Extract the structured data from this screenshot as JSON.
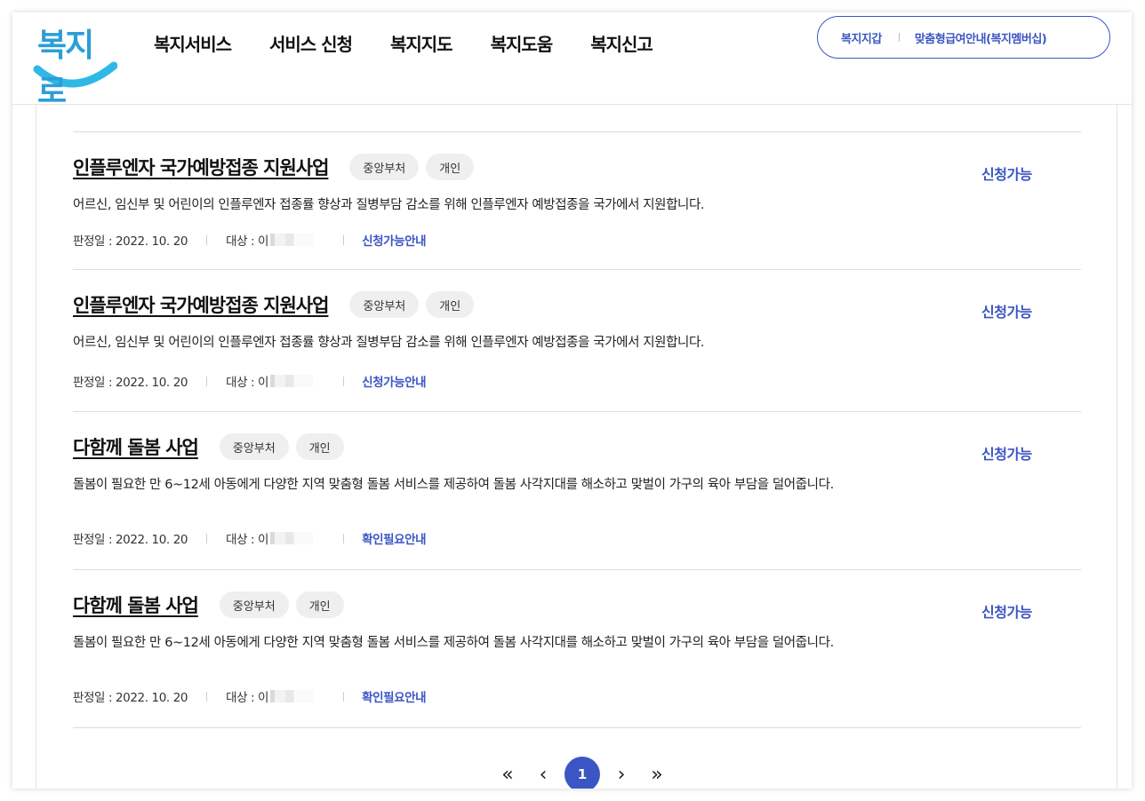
{
  "header": {
    "logo_text": "복지로",
    "nav": [
      "복지서비스",
      "서비스 신청",
      "복지지도",
      "복지도움",
      "복지신고"
    ],
    "util": [
      "복지지갑",
      "맞춤형급여안내(복지멤버십)"
    ]
  },
  "services": [
    {
      "title": "인플루엔자 국가예방접종 지원사업",
      "tags": [
        "중앙부처",
        "개인"
      ],
      "status": "신청가능",
      "description": "어르신, 임신부 및 어린이의 인플루엔자 접종률 향상과 질병부담 감소를 위해  인플루엔자 예방접종을 국가에서 지원합니다.",
      "date_label": "판정일 : 2022. 10. 20",
      "target_label": "대상 : 이",
      "link": "신청가능안내"
    },
    {
      "title": "인플루엔자 국가예방접종 지원사업",
      "tags": [
        "중앙부처",
        "개인"
      ],
      "status": "신청가능",
      "description": "어르신, 임신부 및 어린이의 인플루엔자 접종률 향상과 질병부담 감소를 위해  인플루엔자 예방접종을 국가에서 지원합니다.",
      "date_label": "판정일 : 2022. 10. 20",
      "target_label": "대상 : 이",
      "link": "신청가능안내"
    },
    {
      "title": "다함께 돌봄 사업",
      "tags": [
        "중앙부처",
        "개인"
      ],
      "status": "신청가능",
      "description": "돌봄이 필요한 만 6~12세 아동에게 다양한 지역 맞춤형 돌봄 서비스를 제공하여 돌봄 사각지대를 해소하고 맞벌이 가구의 육아 부담을 덜어줍니다.",
      "date_label": "판정일 : 2022. 10. 20",
      "target_label": "대상 : 이",
      "link": "확인필요안내"
    },
    {
      "title": "다함께 돌봄 사업",
      "tags": [
        "중앙부처",
        "개인"
      ],
      "status": "신청가능",
      "description": "돌봄이 필요한 만 6~12세 아동에게 다양한 지역 맞춤형 돌봄 서비스를 제공하여 돌봄 사각지대를 해소하고 맞벌이 가구의 육아 부담을 덜어줍니다.",
      "date_label": "판정일 : 2022. 10. 20",
      "target_label": "대상 : 이",
      "link": "확인필요안내"
    }
  ],
  "pagination": {
    "first": "«",
    "prev": "‹",
    "current": "1",
    "next": "›",
    "last": "»"
  },
  "colors": {
    "accent": "#3b56c4",
    "logo_blue": "#2b9fd6",
    "tag_bg": "#efefef"
  }
}
